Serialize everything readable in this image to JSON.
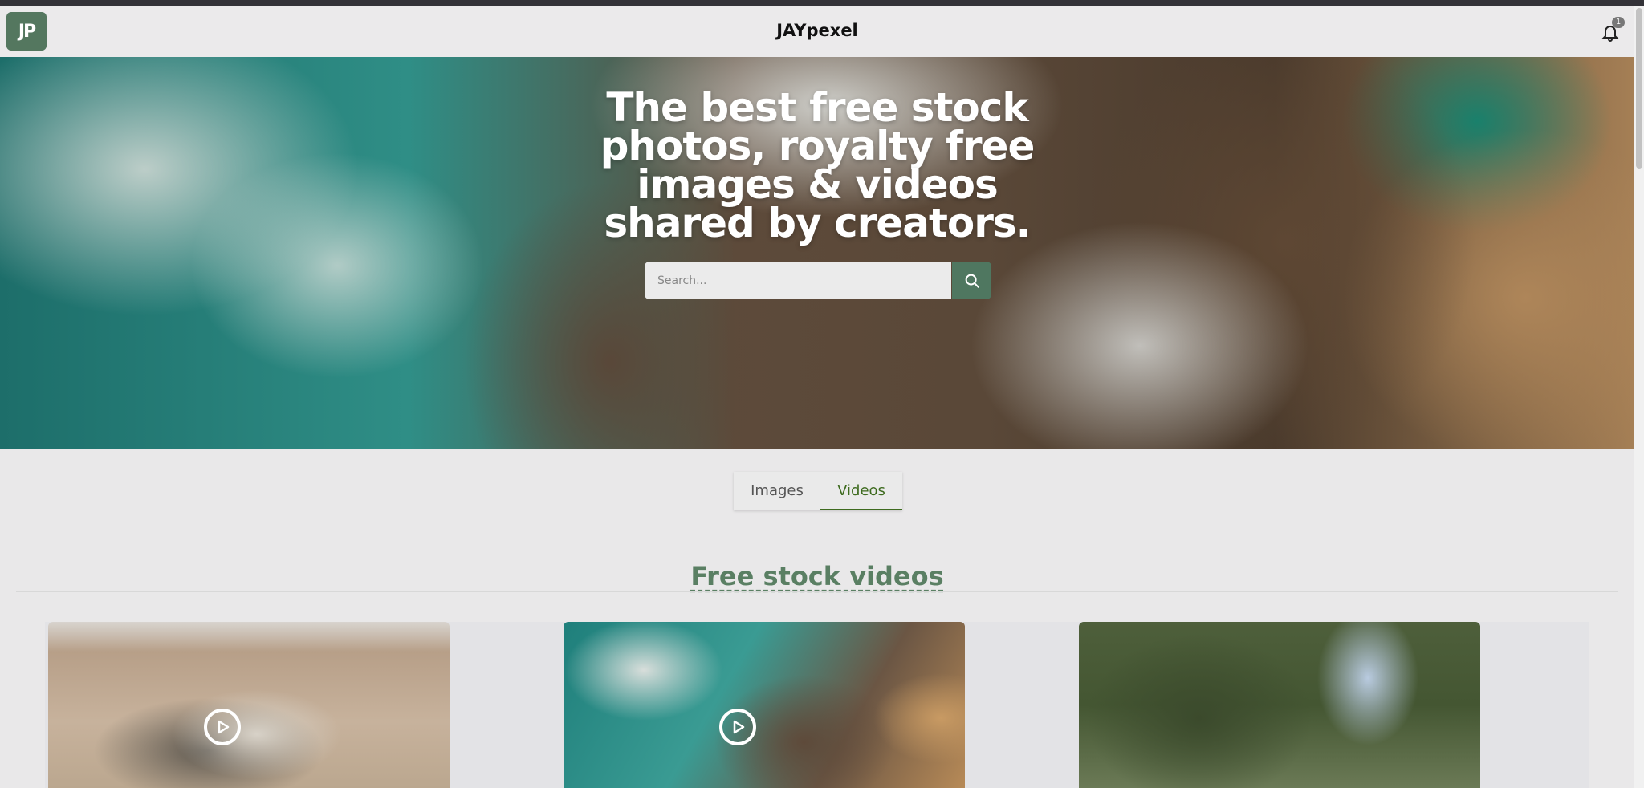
{
  "header": {
    "logo_text": "JP",
    "brand": "JAYpexel",
    "notification_count": "1"
  },
  "hero": {
    "title": "The best free stock photos, royalty free images & videos shared by creators.",
    "search": {
      "placeholder": "Search..."
    }
  },
  "tabs": [
    {
      "label": "Images",
      "active": false
    },
    {
      "label": "Videos",
      "active": true
    }
  ],
  "section": {
    "title": "Free stock videos"
  },
  "colors": {
    "accent": "#4f7760",
    "tab_active": "#3e6b1f",
    "section_title": "#5a7f63"
  },
  "videos": [
    {
      "subject": "seal-on-beach",
      "has_play": true
    },
    {
      "subject": "aerial-ocean-rocks",
      "has_play": true
    },
    {
      "subject": "pine-tree",
      "has_play": false
    }
  ]
}
